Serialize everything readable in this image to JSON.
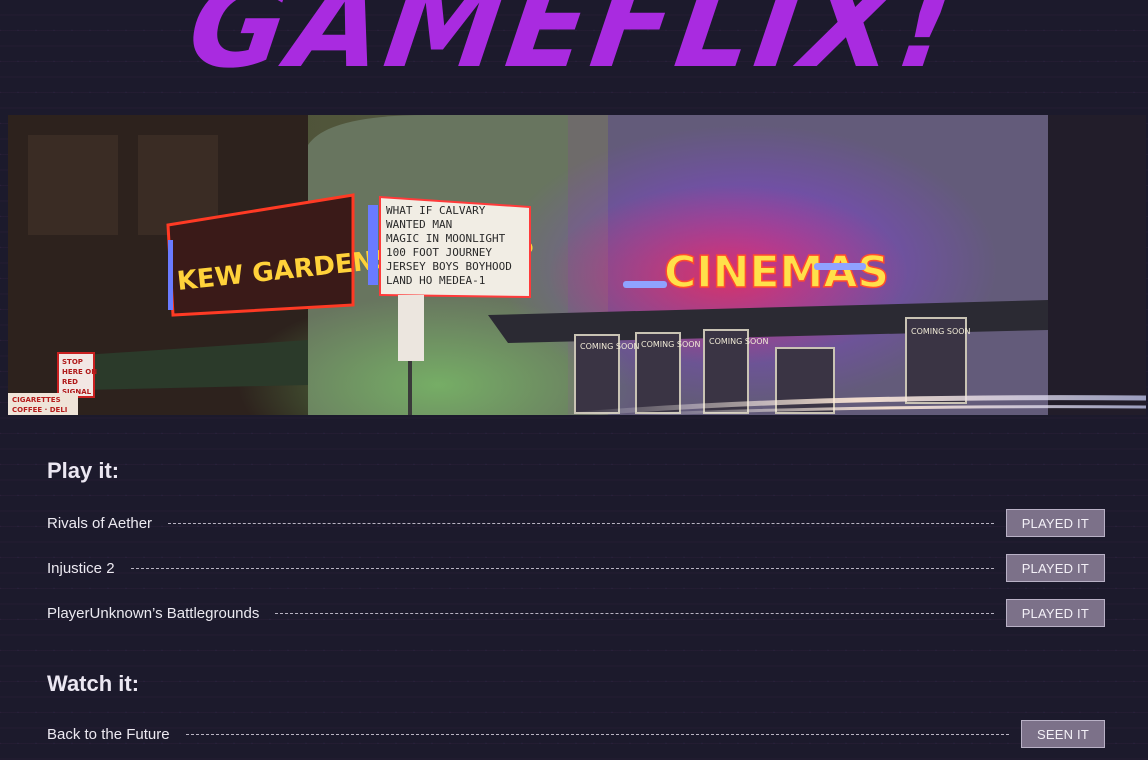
{
  "header": {
    "logo_text": "GAMEFLIX!"
  },
  "banner": {
    "image": "cinema-marquee-night-photo",
    "texts": {
      "marquee_left": "KEW GARDENS CINEMAS",
      "marquee_right": "CINEMAS",
      "board_lines": [
        "WHAT IF    CALVARY",
        "WANTED MAN",
        "MAGIC IN MOONLIGHT",
        "100 FOOT JOURNEY",
        "JERSEY BOYS BOYHOOD",
        "LAND HO    MEDEA-1"
      ],
      "stop_sign": [
        "STOP",
        "HERE ON",
        "RED",
        "SIGNAL"
      ],
      "store_sign": [
        "CIGARETTES",
        "COFFEE · DELI"
      ],
      "coming_soon": "COMING SOON"
    }
  },
  "play": {
    "heading": "Play it:",
    "items": [
      {
        "title": "Rivals of Aether",
        "action": "PLAYED IT"
      },
      {
        "title": "Injustice 2",
        "action": "PLAYED IT"
      },
      {
        "title": "PlayerUnknown’s Battlegrounds",
        "action": "PLAYED IT"
      }
    ]
  },
  "watch": {
    "heading": "Watch it:",
    "items": [
      {
        "title": "Back to the Future",
        "action": "SEEN IT"
      }
    ]
  },
  "colors": {
    "logo": "#a92be0",
    "background": "#1c1a2c",
    "button": "#7c7189"
  }
}
